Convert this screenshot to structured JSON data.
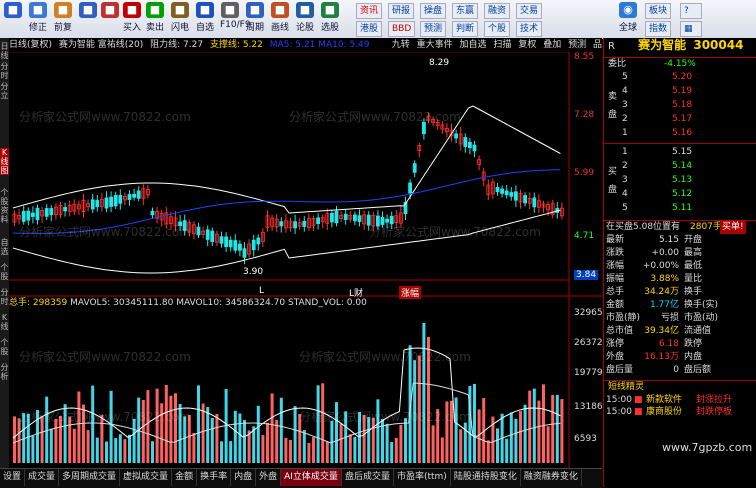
{
  "toolbar": {
    "buttons": [
      {
        "label": "",
        "icon": "back-icon",
        "color": "#2d5fd0"
      },
      {
        "label": "修正",
        "icon": "home-icon",
        "color": "#3a7ad6"
      },
      {
        "label": "前复",
        "icon": "refresh-icon",
        "color": "#d08020"
      },
      {
        "label": "",
        "icon": "scan-icon",
        "color": "#3060c0"
      },
      {
        "label": "",
        "icon": "stop-icon",
        "color": "#c03030"
      },
      {
        "label": "买入",
        "icon": "buy-icon",
        "color": "#c00000"
      },
      {
        "label": "卖出",
        "icon": "sell-icon",
        "color": "#00a000"
      },
      {
        "label": "闪电",
        "icon": "hammer-icon",
        "color": "#806020"
      },
      {
        "label": "自选",
        "icon": "grid-icon",
        "color": "#2050c0"
      },
      {
        "label": "F10/F9",
        "icon": "f10-icon",
        "color": "#606060"
      },
      {
        "label": "周期",
        "icon": "period-icon",
        "color": "#3060c0"
      },
      {
        "label": "画线",
        "icon": "draw-icon",
        "color": "#c05020"
      },
      {
        "label": "论股",
        "icon": "chat-icon",
        "color": "#2060a0"
      },
      {
        "label": "选股",
        "icon": "select-icon",
        "color": "#208040"
      }
    ],
    "quick_row1": [
      "资讯",
      "研报",
      "操盘",
      "东赢",
      "融资",
      "交易"
    ],
    "quick_row2": [
      "港股",
      "BBD",
      "预测",
      "判断",
      "个股",
      "技术"
    ],
    "right_icons": [
      "全球",
      "板块",
      "指数"
    ]
  },
  "left_tabs": [
    "日线",
    "分时",
    "分立",
    "K线图",
    "个股资料",
    "自选",
    "个股",
    "分时",
    "K线",
    "个股",
    "分析"
  ],
  "infobar": {
    "period": "日线(复权)",
    "stock": "赛为智能 富祐线(20)",
    "resist": "阻力线: 7.27",
    "support": "支撑线: 5.22",
    "extra": "MA5: 5.21  MA10: 5.49",
    "tools": [
      "九转",
      "重大事件",
      "加自选",
      "扫描",
      "复权",
      "叠加",
      "预测",
      "品"
    ]
  },
  "price_axis": [
    "8.55",
    "7.28",
    "5.99",
    "4.71",
    "3.84"
  ],
  "price_marks": {
    "high": "8.29",
    "low": "3.90"
  },
  "event_labels": [
    "L",
    "L财",
    "涨幅"
  ],
  "volbar": {
    "label": "总手: 298359",
    "ma5": "MAVOL5: 30345111.80",
    "ma10": "MAVOL10: 34586324.70",
    "std": "STAND_VOL: 0.00"
  },
  "vol_axis": [
    "32965",
    "26372",
    "19779",
    "13186",
    "6593"
  ],
  "bottom_tabs": [
    {
      "label": "设置",
      "active": false
    },
    {
      "label": "成交量",
      "active": false
    },
    {
      "label": "多周期成交量",
      "active": false
    },
    {
      "label": "虚拟成交量",
      "active": false
    },
    {
      "label": "金额",
      "active": false
    },
    {
      "label": "换手率",
      "active": false
    },
    {
      "label": "内盘",
      "active": false
    },
    {
      "label": "外盘",
      "active": false
    },
    {
      "label": "AI立体成交量",
      "active": true
    },
    {
      "label": "盘后成交量",
      "active": false
    },
    {
      "label": "市盈率(ttm)",
      "active": false
    },
    {
      "label": "陆股通持股变化",
      "active": false
    },
    {
      "label": "融资融券变化",
      "active": false
    }
  ],
  "quote": {
    "code_prefix": "R",
    "name": "赛为智能",
    "code": "300044",
    "weibi_label": "委比",
    "weibi": "-4.15%",
    "sell_side": "卖盘",
    "buy_side": "买盘",
    "sells": [
      {
        "lvl": "5",
        "price": "5.20"
      },
      {
        "lvl": "4",
        "price": "5.19"
      },
      {
        "lvl": "3",
        "price": "5.18"
      },
      {
        "lvl": "2",
        "price": "5.17"
      },
      {
        "lvl": "1",
        "price": "5.16"
      }
    ],
    "buys": [
      {
        "lvl": "1",
        "price": "5.15"
      },
      {
        "lvl": "2",
        "price": "5.14"
      },
      {
        "lvl": "3",
        "price": "5.13"
      },
      {
        "lvl": "4",
        "price": "5.12"
      },
      {
        "lvl": "5",
        "price": "5.11"
      }
    ],
    "notice": "在买盘5.08位置有",
    "notice_qty": "2807手",
    "notice_tag": "买单!",
    "stats": [
      {
        "l1": "最新",
        "v1": "5.15",
        "c1": "wht",
        "l2": "开盘",
        "v2": "",
        "c2": "wht"
      },
      {
        "l1": "涨跌",
        "v1": "+0.00",
        "c1": "wht",
        "l2": "最高",
        "v2": "",
        "c2": "wht"
      },
      {
        "l1": "涨幅",
        "v1": "+0.00%",
        "c1": "wht",
        "l2": "最低",
        "v2": "",
        "c2": "wht"
      },
      {
        "l1": "振幅",
        "v1": "3.88%",
        "c1": "yel",
        "l2": "量比",
        "v2": "",
        "c2": "wht"
      },
      {
        "l1": "总手",
        "v1": "34.24万",
        "c1": "yel",
        "l2": "换手",
        "v2": "",
        "c2": "wht"
      },
      {
        "l1": "金额",
        "v1": "1.77亿",
        "c1": "cy",
        "l2": "换手(实)",
        "v2": "",
        "c2": "wht"
      },
      {
        "l1": "市盈(静)",
        "v1": "亏损",
        "c1": "wht",
        "l2": "市盈(动)",
        "v2": "",
        "c2": "wht"
      },
      {
        "l1": "总市值",
        "v1": "39.34亿",
        "c1": "yel",
        "l2": "流通值",
        "v2": "",
        "c2": "wht"
      },
      {
        "l1": "涨停",
        "v1": "6.18",
        "c1": "red",
        "l2": "跌停",
        "v2": "",
        "c2": "wht"
      },
      {
        "l1": "外盘",
        "v1": "16.13万",
        "c1": "red",
        "l2": "内盘",
        "v2": "",
        "c2": "wht"
      },
      {
        "l1": "盘后量",
        "v1": "0",
        "c1": "wht",
        "l2": "盘后额",
        "v2": "",
        "c2": "wht"
      }
    ],
    "section_title": "短线精灵",
    "events": [
      {
        "time": "15:00",
        "qty": "■",
        "label": "新款软件",
        "tag": "封涨拉升"
      },
      {
        "time": "15:00",
        "qty": "■",
        "label": "康商股份",
        "tag": "封跌停板"
      }
    ]
  },
  "watermark": "分析家公式网www.70822.com",
  "brand": "www.7gpzb.com"
}
